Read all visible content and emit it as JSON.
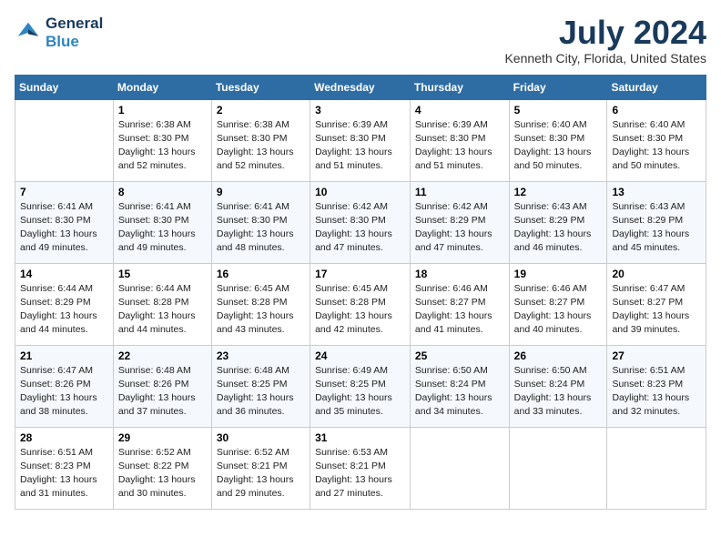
{
  "header": {
    "logo_line1": "General",
    "logo_line2": "Blue",
    "month": "July 2024",
    "location": "Kenneth City, Florida, United States"
  },
  "weekdays": [
    "Sunday",
    "Monday",
    "Tuesday",
    "Wednesday",
    "Thursday",
    "Friday",
    "Saturday"
  ],
  "weeks": [
    [
      {
        "day": "",
        "sunrise": "",
        "sunset": "",
        "daylight": ""
      },
      {
        "day": "1",
        "sunrise": "Sunrise: 6:38 AM",
        "sunset": "Sunset: 8:30 PM",
        "daylight": "Daylight: 13 hours and 52 minutes."
      },
      {
        "day": "2",
        "sunrise": "Sunrise: 6:38 AM",
        "sunset": "Sunset: 8:30 PM",
        "daylight": "Daylight: 13 hours and 52 minutes."
      },
      {
        "day": "3",
        "sunrise": "Sunrise: 6:39 AM",
        "sunset": "Sunset: 8:30 PM",
        "daylight": "Daylight: 13 hours and 51 minutes."
      },
      {
        "day": "4",
        "sunrise": "Sunrise: 6:39 AM",
        "sunset": "Sunset: 8:30 PM",
        "daylight": "Daylight: 13 hours and 51 minutes."
      },
      {
        "day": "5",
        "sunrise": "Sunrise: 6:40 AM",
        "sunset": "Sunset: 8:30 PM",
        "daylight": "Daylight: 13 hours and 50 minutes."
      },
      {
        "day": "6",
        "sunrise": "Sunrise: 6:40 AM",
        "sunset": "Sunset: 8:30 PM",
        "daylight": "Daylight: 13 hours and 50 minutes."
      }
    ],
    [
      {
        "day": "7",
        "sunrise": "Sunrise: 6:41 AM",
        "sunset": "Sunset: 8:30 PM",
        "daylight": "Daylight: 13 hours and 49 minutes."
      },
      {
        "day": "8",
        "sunrise": "Sunrise: 6:41 AM",
        "sunset": "Sunset: 8:30 PM",
        "daylight": "Daylight: 13 hours and 49 minutes."
      },
      {
        "day": "9",
        "sunrise": "Sunrise: 6:41 AM",
        "sunset": "Sunset: 8:30 PM",
        "daylight": "Daylight: 13 hours and 48 minutes."
      },
      {
        "day": "10",
        "sunrise": "Sunrise: 6:42 AM",
        "sunset": "Sunset: 8:30 PM",
        "daylight": "Daylight: 13 hours and 47 minutes."
      },
      {
        "day": "11",
        "sunrise": "Sunrise: 6:42 AM",
        "sunset": "Sunset: 8:29 PM",
        "daylight": "Daylight: 13 hours and 47 minutes."
      },
      {
        "day": "12",
        "sunrise": "Sunrise: 6:43 AM",
        "sunset": "Sunset: 8:29 PM",
        "daylight": "Daylight: 13 hours and 46 minutes."
      },
      {
        "day": "13",
        "sunrise": "Sunrise: 6:43 AM",
        "sunset": "Sunset: 8:29 PM",
        "daylight": "Daylight: 13 hours and 45 minutes."
      }
    ],
    [
      {
        "day": "14",
        "sunrise": "Sunrise: 6:44 AM",
        "sunset": "Sunset: 8:29 PM",
        "daylight": "Daylight: 13 hours and 44 minutes."
      },
      {
        "day": "15",
        "sunrise": "Sunrise: 6:44 AM",
        "sunset": "Sunset: 8:28 PM",
        "daylight": "Daylight: 13 hours and 44 minutes."
      },
      {
        "day": "16",
        "sunrise": "Sunrise: 6:45 AM",
        "sunset": "Sunset: 8:28 PM",
        "daylight": "Daylight: 13 hours and 43 minutes."
      },
      {
        "day": "17",
        "sunrise": "Sunrise: 6:45 AM",
        "sunset": "Sunset: 8:28 PM",
        "daylight": "Daylight: 13 hours and 42 minutes."
      },
      {
        "day": "18",
        "sunrise": "Sunrise: 6:46 AM",
        "sunset": "Sunset: 8:27 PM",
        "daylight": "Daylight: 13 hours and 41 minutes."
      },
      {
        "day": "19",
        "sunrise": "Sunrise: 6:46 AM",
        "sunset": "Sunset: 8:27 PM",
        "daylight": "Daylight: 13 hours and 40 minutes."
      },
      {
        "day": "20",
        "sunrise": "Sunrise: 6:47 AM",
        "sunset": "Sunset: 8:27 PM",
        "daylight": "Daylight: 13 hours and 39 minutes."
      }
    ],
    [
      {
        "day": "21",
        "sunrise": "Sunrise: 6:47 AM",
        "sunset": "Sunset: 8:26 PM",
        "daylight": "Daylight: 13 hours and 38 minutes."
      },
      {
        "day": "22",
        "sunrise": "Sunrise: 6:48 AM",
        "sunset": "Sunset: 8:26 PM",
        "daylight": "Daylight: 13 hours and 37 minutes."
      },
      {
        "day": "23",
        "sunrise": "Sunrise: 6:48 AM",
        "sunset": "Sunset: 8:25 PM",
        "daylight": "Daylight: 13 hours and 36 minutes."
      },
      {
        "day": "24",
        "sunrise": "Sunrise: 6:49 AM",
        "sunset": "Sunset: 8:25 PM",
        "daylight": "Daylight: 13 hours and 35 minutes."
      },
      {
        "day": "25",
        "sunrise": "Sunrise: 6:50 AM",
        "sunset": "Sunset: 8:24 PM",
        "daylight": "Daylight: 13 hours and 34 minutes."
      },
      {
        "day": "26",
        "sunrise": "Sunrise: 6:50 AM",
        "sunset": "Sunset: 8:24 PM",
        "daylight": "Daylight: 13 hours and 33 minutes."
      },
      {
        "day": "27",
        "sunrise": "Sunrise: 6:51 AM",
        "sunset": "Sunset: 8:23 PM",
        "daylight": "Daylight: 13 hours and 32 minutes."
      }
    ],
    [
      {
        "day": "28",
        "sunrise": "Sunrise: 6:51 AM",
        "sunset": "Sunset: 8:23 PM",
        "daylight": "Daylight: 13 hours and 31 minutes."
      },
      {
        "day": "29",
        "sunrise": "Sunrise: 6:52 AM",
        "sunset": "Sunset: 8:22 PM",
        "daylight": "Daylight: 13 hours and 30 minutes."
      },
      {
        "day": "30",
        "sunrise": "Sunrise: 6:52 AM",
        "sunset": "Sunset: 8:21 PM",
        "daylight": "Daylight: 13 hours and 29 minutes."
      },
      {
        "day": "31",
        "sunrise": "Sunrise: 6:53 AM",
        "sunset": "Sunset: 8:21 PM",
        "daylight": "Daylight: 13 hours and 27 minutes."
      },
      {
        "day": "",
        "sunrise": "",
        "sunset": "",
        "daylight": ""
      },
      {
        "day": "",
        "sunrise": "",
        "sunset": "",
        "daylight": ""
      },
      {
        "day": "",
        "sunrise": "",
        "sunset": "",
        "daylight": ""
      }
    ]
  ]
}
